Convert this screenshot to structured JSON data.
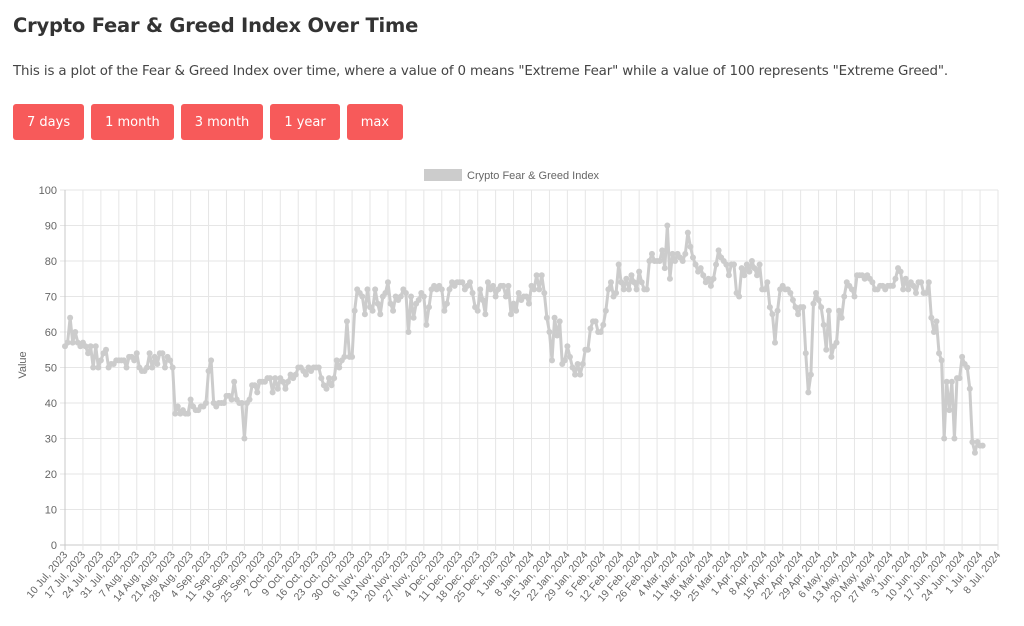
{
  "header": {
    "title": "Crypto Fear & Greed Index Over Time",
    "description": "This is a plot of the Fear & Greed Index over time, where a value of 0 means \"Extreme Fear\" while a value of 100 represents \"Extreme Greed\"."
  },
  "range_buttons": [
    {
      "label": "7 days"
    },
    {
      "label": "1 month"
    },
    {
      "label": "3 month"
    },
    {
      "label": "1 year"
    },
    {
      "label": "max"
    }
  ],
  "colors": {
    "button_bg": "#f75a5a",
    "series": "#cccccc",
    "grid": "#e6e6e6"
  },
  "chart_data": {
    "type": "line",
    "title": "",
    "xlabel": "",
    "ylabel": "Value",
    "ylim": [
      0,
      100
    ],
    "yticks": [
      0,
      10,
      20,
      30,
      40,
      50,
      60,
      70,
      80,
      90,
      100
    ],
    "grid": true,
    "legend": {
      "position": "top-center",
      "entries": [
        "Crypto Fear & Greed Index"
      ]
    },
    "x_tick_labels": [
      "10 Jul, 2023",
      "17 Jul, 2023",
      "24 Jul, 2023",
      "31 Jul, 2023",
      "7 Aug, 2023",
      "14 Aug, 2023",
      "21 Aug, 2023",
      "28 Aug, 2023",
      "4 Sep, 2023",
      "11 Sep, 2023",
      "18 Sep, 2023",
      "25 Sep, 2023",
      "2 Oct, 2023",
      "9 Oct, 2023",
      "16 Oct, 2023",
      "23 Oct, 2023",
      "30 Oct, 2023",
      "6 Nov, 2023",
      "13 Nov, 2023",
      "20 Nov, 2023",
      "27 Nov, 2023",
      "4 Dec, 2023",
      "11 Dec, 2023",
      "18 Dec, 2023",
      "25 Dec, 2023",
      "1 Jan, 2024",
      "8 Jan, 2024",
      "15 Jan, 2024",
      "22 Jan, 2024",
      "29 Jan, 2024",
      "5 Feb, 2024",
      "12 Feb, 2024",
      "19 Feb, 2024",
      "26 Feb, 2024",
      "4 Mar, 2024",
      "11 Mar, 2024",
      "18 Mar, 2024",
      "25 Mar, 2024",
      "1 Apr, 2024",
      "8 Apr, 2024",
      "15 Apr, 2024",
      "22 Apr, 2024",
      "29 Apr, 2024",
      "6 May, 2024",
      "13 May, 2024",
      "20 May, 2024",
      "27 May, 2024",
      "3 Jun, 2024",
      "10 Jun, 2024",
      "17 Jun, 2024",
      "24 Jun, 2024",
      "1 Jul, 2024",
      "8 Jul, 2024"
    ],
    "start_date": "10 Jul, 2023",
    "interval": "daily",
    "series": [
      {
        "name": "Crypto Fear & Greed Index",
        "values": [
          56,
          57,
          64,
          57,
          60,
          57,
          56,
          57,
          56,
          54,
          56,
          50,
          56,
          50,
          52,
          54,
          55,
          50,
          51,
          51,
          52,
          52,
          52,
          52,
          50,
          53,
          53,
          52,
          54,
          50,
          49,
          49,
          50,
          54,
          50,
          53,
          51,
          54,
          54,
          50,
          53,
          52,
          50,
          37,
          39,
          37,
          38,
          37,
          37,
          41,
          39,
          38,
          38,
          39,
          39,
          40,
          49,
          52,
          40,
          39,
          40,
          40,
          40,
          42,
          42,
          41,
          46,
          41,
          40,
          40,
          30,
          40,
          41,
          45,
          45,
          43,
          46,
          46,
          46,
          47,
          47,
          43,
          47,
          44,
          47,
          46,
          44,
          46,
          48,
          47,
          48,
          50,
          50,
          49,
          48,
          50,
          49,
          50,
          50,
          50,
          47,
          45,
          44,
          47,
          45,
          47,
          52,
          50,
          52,
          53,
          63,
          53,
          53,
          66,
          72,
          71,
          70,
          65,
          72,
          67,
          66,
          72,
          68,
          65,
          70,
          71,
          74,
          68,
          66,
          70,
          69,
          70,
          72,
          71,
          60,
          70,
          64,
          68,
          69,
          71,
          70,
          62,
          67,
          72,
          73,
          72,
          73,
          72,
          66,
          68,
          72,
          74,
          73,
          74,
          74,
          74,
          72,
          73,
          74,
          71,
          67,
          66,
          72,
          69,
          65,
          74,
          72,
          73,
          70,
          72,
          73,
          73,
          70,
          73,
          65,
          68,
          66,
          71,
          69,
          70,
          70,
          68,
          73,
          72,
          76,
          72,
          76,
          71,
          64,
          60,
          52,
          64,
          59,
          63,
          51,
          52,
          56,
          53,
          50,
          48,
          51,
          48,
          51,
          55,
          55,
          61,
          63,
          63,
          60,
          60,
          62,
          66,
          72,
          74,
          70,
          71,
          79,
          74,
          72,
          75,
          72,
          76,
          74,
          72,
          77,
          74,
          72,
          72,
          80,
          82,
          80,
          80,
          80,
          83,
          78,
          90,
          75,
          82,
          80,
          82,
          81,
          80,
          82,
          88,
          84,
          81,
          79,
          77,
          78,
          76,
          74,
          75,
          73,
          75,
          79,
          83,
          81,
          80,
          79,
          76,
          79,
          79,
          71,
          70,
          78,
          76,
          79,
          77,
          80,
          78,
          76,
          79,
          72,
          72,
          74,
          67,
          65,
          57,
          66,
          72,
          73,
          72,
          72,
          71,
          69,
          67,
          65,
          67,
          67,
          54,
          43,
          48,
          68,
          71,
          69,
          67,
          62,
          55,
          66,
          53,
          56,
          57,
          66,
          64,
          70,
          74,
          73,
          72,
          70,
          76,
          76,
          76,
          75,
          76,
          75,
          74,
          72,
          72,
          73,
          73,
          72,
          73,
          73,
          73,
          75,
          78,
          77,
          72,
          75,
          72,
          74,
          73,
          71,
          74,
          74,
          71,
          71,
          74,
          64,
          60,
          63,
          54,
          52,
          30,
          46,
          38,
          46,
          30,
          47,
          47,
          53,
          51,
          50,
          44,
          29,
          26,
          29,
          28,
          28
        ]
      }
    ]
  }
}
